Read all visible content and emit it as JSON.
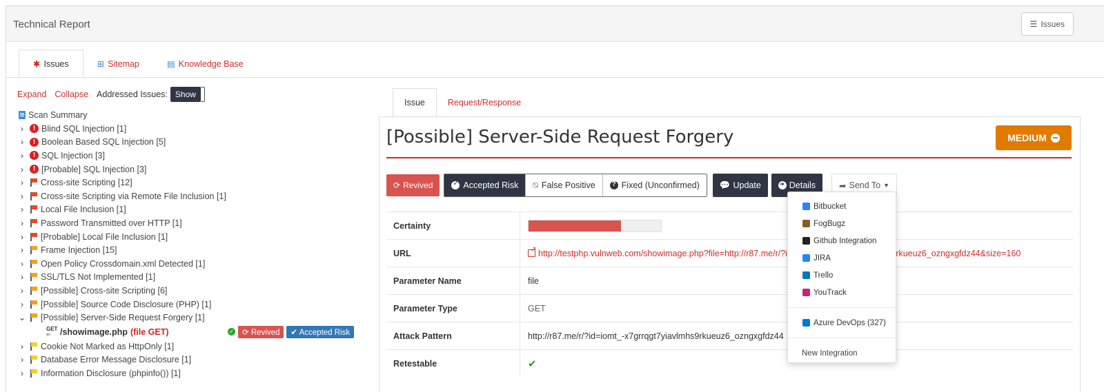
{
  "header": {
    "title": "Technical Report",
    "issues_button": "Issues"
  },
  "main_tabs": [
    {
      "label": "Issues",
      "icon": "bug-icon"
    },
    {
      "label": "Sitemap",
      "icon": "sitemap-icon"
    },
    {
      "label": "Knowledge Base",
      "icon": "book-icon"
    }
  ],
  "controls": {
    "expand": "Expand",
    "collapse": "Collapse",
    "addressed_label": "Addressed Issues:",
    "show_toggle": "Show"
  },
  "tree": {
    "root": "Scan Summary",
    "items": [
      {
        "label": "Blind SQL Injection [1]",
        "severity": "critical",
        "expanded": false
      },
      {
        "label": "Boolean Based SQL Injection [5]",
        "severity": "critical",
        "expanded": false
      },
      {
        "label": "SQL Injection [3]",
        "severity": "critical",
        "expanded": false
      },
      {
        "label": "[Probable] SQL Injection [3]",
        "severity": "critical",
        "expanded": false
      },
      {
        "label": "Cross-site Scripting [12]",
        "severity": "high",
        "expanded": false
      },
      {
        "label": "Cross-site Scripting via Remote File Inclusion [1]",
        "severity": "high",
        "expanded": false
      },
      {
        "label": "Local File Inclusion [1]",
        "severity": "high",
        "expanded": false
      },
      {
        "label": "Password Transmitted over HTTP [1]",
        "severity": "high",
        "expanded": false
      },
      {
        "label": "[Probable] Local File Inclusion [1]",
        "severity": "high",
        "expanded": false
      },
      {
        "label": "Frame Injection [15]",
        "severity": "medium",
        "expanded": false
      },
      {
        "label": "Open Policy Crossdomain.xml Detected [1]",
        "severity": "medium",
        "expanded": false
      },
      {
        "label": "SSL/TLS Not Implemented [1]",
        "severity": "medium",
        "expanded": false
      },
      {
        "label": "[Possible] Cross-site Scripting [6]",
        "severity": "medium",
        "expanded": false
      },
      {
        "label": "[Possible] Source Code Disclosure (PHP) [1]",
        "severity": "medium",
        "expanded": false
      },
      {
        "label": "[Possible] Server-Side Request Forgery [1]",
        "severity": "medium",
        "expanded": true
      }
    ],
    "sub_item": {
      "method": "GET",
      "path": "/showimage.php",
      "param": "(file GET)",
      "badge_revived": "Revived",
      "badge_accepted": "Accepted Risk"
    },
    "items_after": [
      {
        "label": "Cookie Not Marked as HttpOnly [1]",
        "severity": "low"
      },
      {
        "label": "Database Error Message Disclosure [1]",
        "severity": "low"
      },
      {
        "label": "Information Disclosure (phpinfo()) [1]",
        "severity": "low"
      }
    ]
  },
  "detail_tabs": [
    {
      "label": "Issue"
    },
    {
      "label": "Request/Response"
    }
  ],
  "detail": {
    "title": "[Possible] Server-Side Request Forgery",
    "severity": "MEDIUM",
    "buttons": {
      "revived": "Revived",
      "accepted_risk": "Accepted Risk",
      "false_positive": "False Positive",
      "fixed": "Fixed (Unconfirmed)",
      "update": "Update",
      "details": "Details",
      "send_to": "Send To"
    },
    "rows": {
      "certainty_label": "Certainty",
      "certainty_value": 0.7,
      "url_label": "URL",
      "url_value": "http://testphp.vulnweb.com/showimage.php?file=http://r87.me/r/?id=iomt_-x7grrqgt7yiavlmhs9rkueuz6_ozngxgfdz44&size=160",
      "param_name_label": "Parameter Name",
      "param_name_value": "file",
      "param_type_label": "Parameter Type",
      "param_type_value": "GET",
      "attack_label": "Attack Pattern",
      "attack_value": "http://r87.me/r/?id=iomt_-x7grrqgt7yiavlmhs9rkueuz6_ozngxgfdz44",
      "retestable_label": "Retestable"
    }
  },
  "send_to_menu": {
    "items": [
      {
        "label": "Bitbucket",
        "icon": "bitbucket-icon",
        "color": "#2684ff"
      },
      {
        "label": "FogBugz",
        "icon": "fogbugz-icon",
        "color": "#8a5a2b"
      },
      {
        "label": "Github Integration",
        "icon": "github-icon",
        "color": "#222222"
      },
      {
        "label": "JIRA",
        "icon": "jira-icon",
        "color": "#2684ff"
      },
      {
        "label": "Trello",
        "icon": "trello-icon",
        "color": "#0079bf"
      },
      {
        "label": "YouTrack",
        "icon": "youtrack-icon",
        "color": "#c4267a"
      }
    ],
    "azure": {
      "label": "Azure DevOps (327)",
      "icon": "azure-devops-icon",
      "color": "#0078d4"
    },
    "new_integration": "New Integration"
  },
  "colors": {
    "accent_red": "#c9302c",
    "dark_button": "#2f3542",
    "medium_badge": "#e07b00",
    "revived": "#d9534f",
    "accepted": "#3277b6"
  }
}
